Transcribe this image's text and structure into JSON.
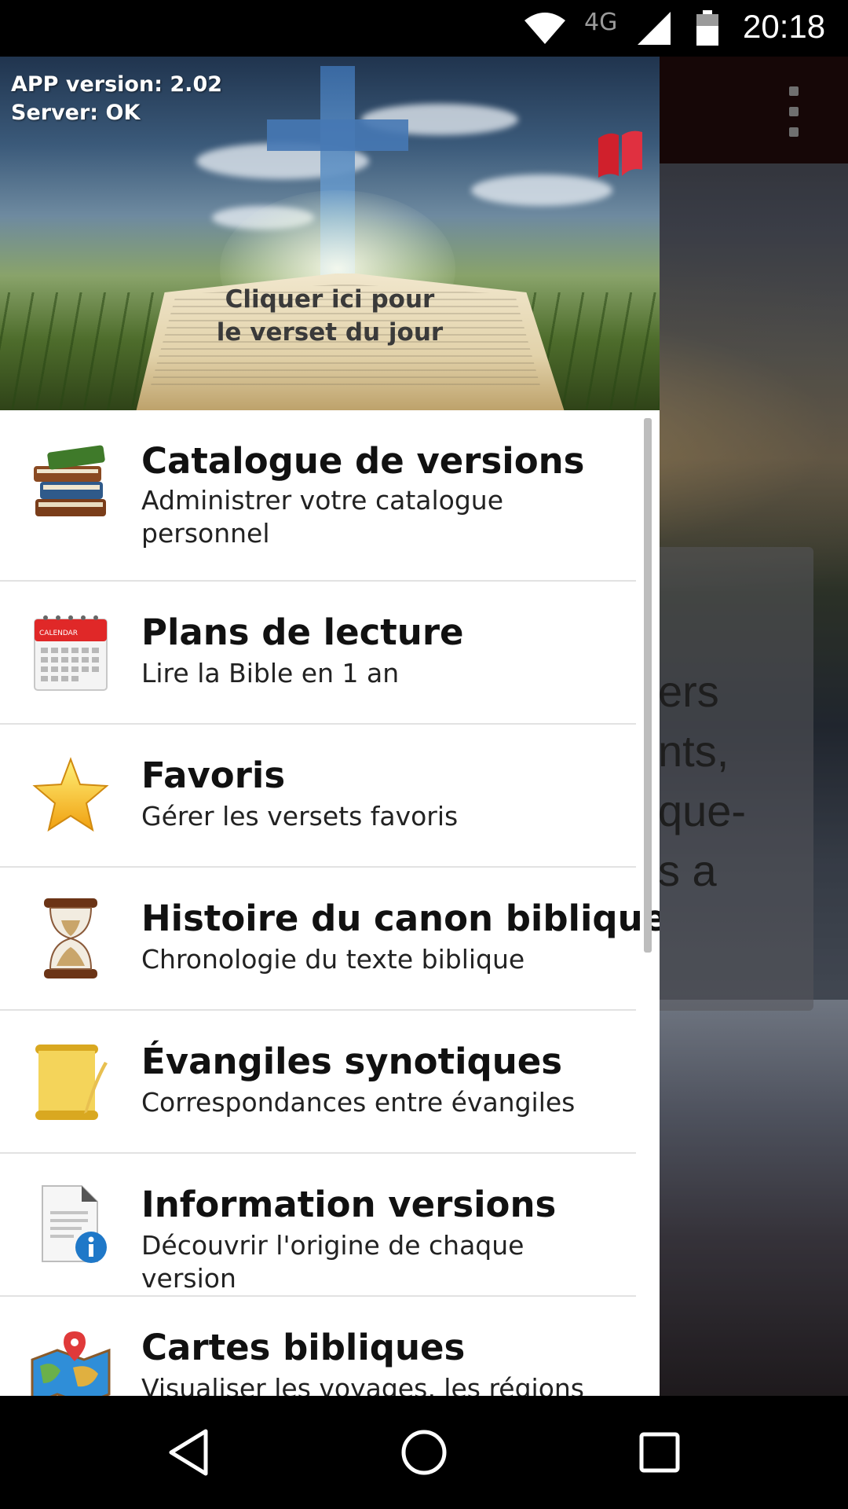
{
  "status_bar": {
    "network": "4G",
    "time": "20:18",
    "icons": [
      "wifi-icon",
      "cell-signal-icon",
      "battery-icon"
    ]
  },
  "drawer_header": {
    "app_version": "APP version: 2.02",
    "server_status": "Server: OK",
    "verse_line1": "Cliquer ici pour",
    "verse_line2": "le verset du jour"
  },
  "menu": {
    "items": [
      {
        "icon": "books-icon",
        "title": "Catalogue de versions",
        "subtitle": "Administrer votre catalogue personnel"
      },
      {
        "icon": "calendar-icon",
        "title": "Plans de lecture",
        "subtitle": "Lire la Bible en 1 an"
      },
      {
        "icon": "star-icon",
        "title": "Favoris",
        "subtitle": "Gérer les versets favoris"
      },
      {
        "icon": "hourglass-icon",
        "title": "Histoire du canon biblique",
        "subtitle": "Chronologie du texte biblique"
      },
      {
        "icon": "scroll-icon",
        "title": "Évangiles synotiques",
        "subtitle": "Correspondances entre évangiles"
      },
      {
        "icon": "document-info-icon",
        "title": "Information versions",
        "subtitle": "Découvrir l'origine de chaque version"
      },
      {
        "icon": "map-pin-icon",
        "title": "Cartes bibliques",
        "subtitle": "Visualiser les voyages, les régions"
      }
    ],
    "calendar_label": "CALENDAR"
  },
  "background_app": {
    "card_text": "ers\nnts,\nque-\ns a"
  },
  "colors": {
    "drawer_bg": "#ffffff",
    "title_text": "#111111",
    "divider": "#e2e2e2",
    "toolbar": "#1f0b0b",
    "flag_red": "#d0202c"
  }
}
